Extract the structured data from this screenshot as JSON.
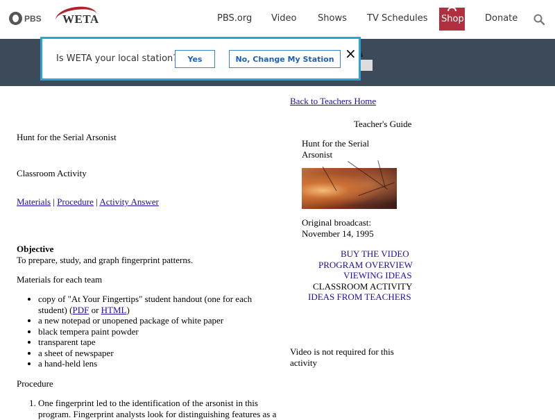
{
  "header": {
    "pbs_logo": "PBS",
    "weta_logo": "WETA",
    "nav": [
      "PBS.org",
      "Video",
      "Shows",
      "TV Schedules",
      "Donate"
    ],
    "shop_label": "Shop",
    "colors": {
      "shop": "#b03040",
      "band": "#3d4a5a",
      "popup_border": "#2aa4d6"
    }
  },
  "band": {
    "partial_text": "ers"
  },
  "popup": {
    "question": "Is WETA your local station?",
    "yes_label": "Yes",
    "change_label": "No, Change My Station",
    "close_icon": "×"
  },
  "right": {
    "back_link": "Back to Teachers Home",
    "guide_heading": "Teacher's Guide",
    "episode_title_line1": "Hunt for the Serial",
    "episode_title_line2": "Arsonist",
    "broadcast_label": "Original broadcast:",
    "broadcast_date": "November 14, 1995",
    "links": {
      "buy": "BUY THE VIDEO",
      "overview": "PROGRAM OVERVIEW",
      "viewing": "VIEWING IDEAS",
      "activity": "CLASSROOM ACTIVITY",
      "ideas": "IDEAS FROM TEACHERS"
    },
    "video_note_line1": "Video is not required for this",
    "video_note_line2": "activity"
  },
  "left": {
    "title": "Hunt for the Serial Arsonist",
    "subtitle": "Classroom Activity",
    "tabs": {
      "materials": "Materials",
      "procedure": "Procedure",
      "answer": "Activity Answer",
      "sep": "|"
    },
    "objective_heading": "Objective",
    "objective_text": "To prepare, study, and graph fingerprint patterns.",
    "materials_heading": "Materials for each team",
    "materials": {
      "first_line": "copy of \"At Your Fingertips\" student handout (one for each",
      "first_cont": "student) (",
      "pdf": "PDF",
      "or": " or ",
      "html": "HTML",
      "close_paren": ")",
      "items": [
        "a new notepad or unopened package of white paper",
        "black tempera paint powder",
        "transparent tape",
        "a sheet of newspaper",
        "a hand-held lens"
      ]
    },
    "procedure_heading": "Procedure",
    "procedure_step1": "One fingerprint led to the identification of the arsonist in this program. Fingerprint analysts look for distinguishing features as a"
  }
}
